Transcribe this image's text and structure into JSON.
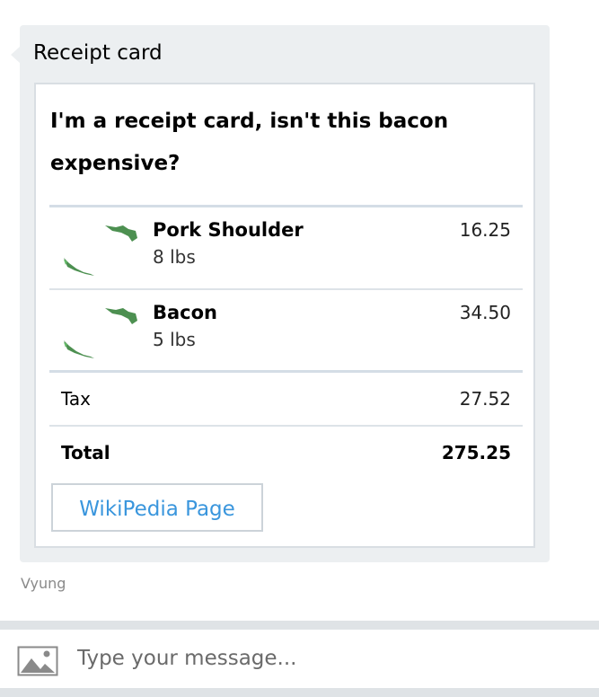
{
  "bubble": {
    "title": "Receipt card",
    "sender": "Vyung"
  },
  "receipt": {
    "title": "I'm a receipt card, isn't this bacon expensive?",
    "items": [
      {
        "name": "Pork Shoulder",
        "quantity": "8 lbs",
        "price": "16.25",
        "image": "thumbnail-icon"
      },
      {
        "name": "Bacon",
        "quantity": "5 lbs",
        "price": "34.50",
        "image": "thumbnail-icon"
      }
    ],
    "tax_label": "Tax",
    "tax_value": "27.52",
    "total_label": "Total",
    "total_value": "275.25",
    "button_label": "WikiPedia Page"
  },
  "composer": {
    "placeholder": "Type your message...",
    "image_icon": "image-upload-icon"
  },
  "colors": {
    "bubble_bg": "#eceff1",
    "link_blue": "#3a96dd",
    "divider": "#d4dde6"
  }
}
